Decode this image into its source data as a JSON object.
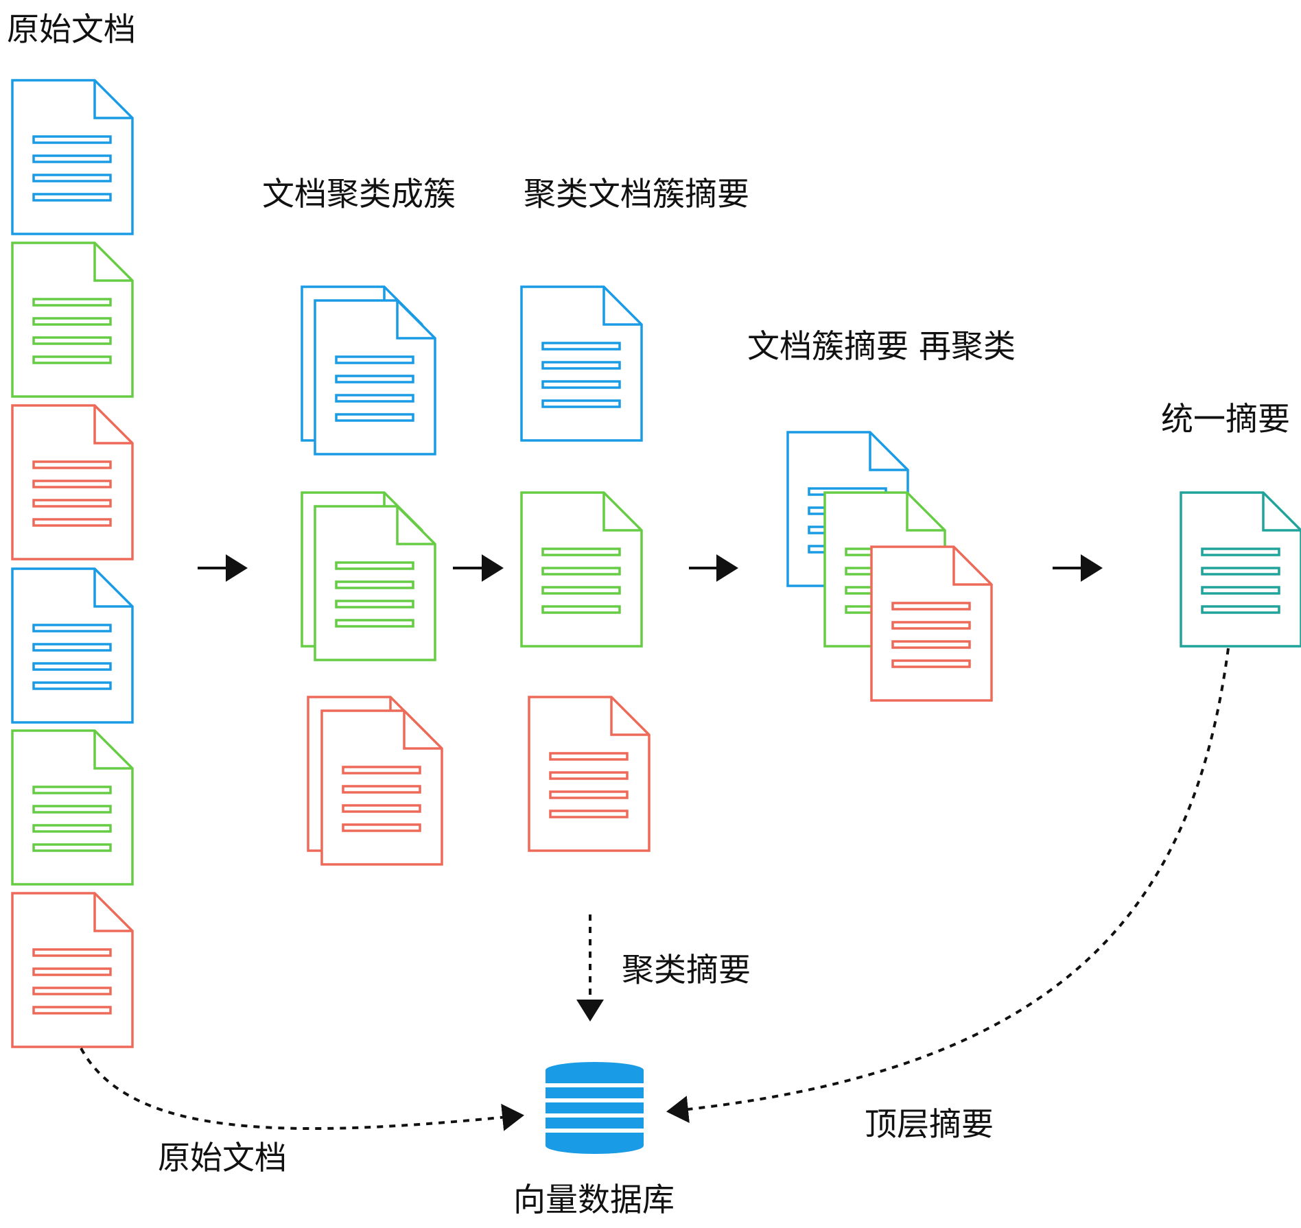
{
  "labels": {
    "original_docs_title": "原始文档",
    "cluster_docs": "文档聚类成簇",
    "cluster_summary": "聚类文档簇摘要",
    "recluster": "文档簇摘要 再聚类",
    "unified_summary": "统一摘要",
    "cluster_summaries_edge": "聚类摘要",
    "original_docs_edge": "原始文档",
    "top_summary_edge": "顶层摘要",
    "vector_db": "向量数据库"
  },
  "colors": {
    "blue": "#1a9be6",
    "green": "#66cc44",
    "red": "#ee6a58",
    "teal": "#1fa39a",
    "black": "#111111",
    "database": "#1a9be6"
  },
  "icons": {
    "document": "document-icon",
    "database": "database-icon",
    "arrow": "arrow-right-icon"
  }
}
